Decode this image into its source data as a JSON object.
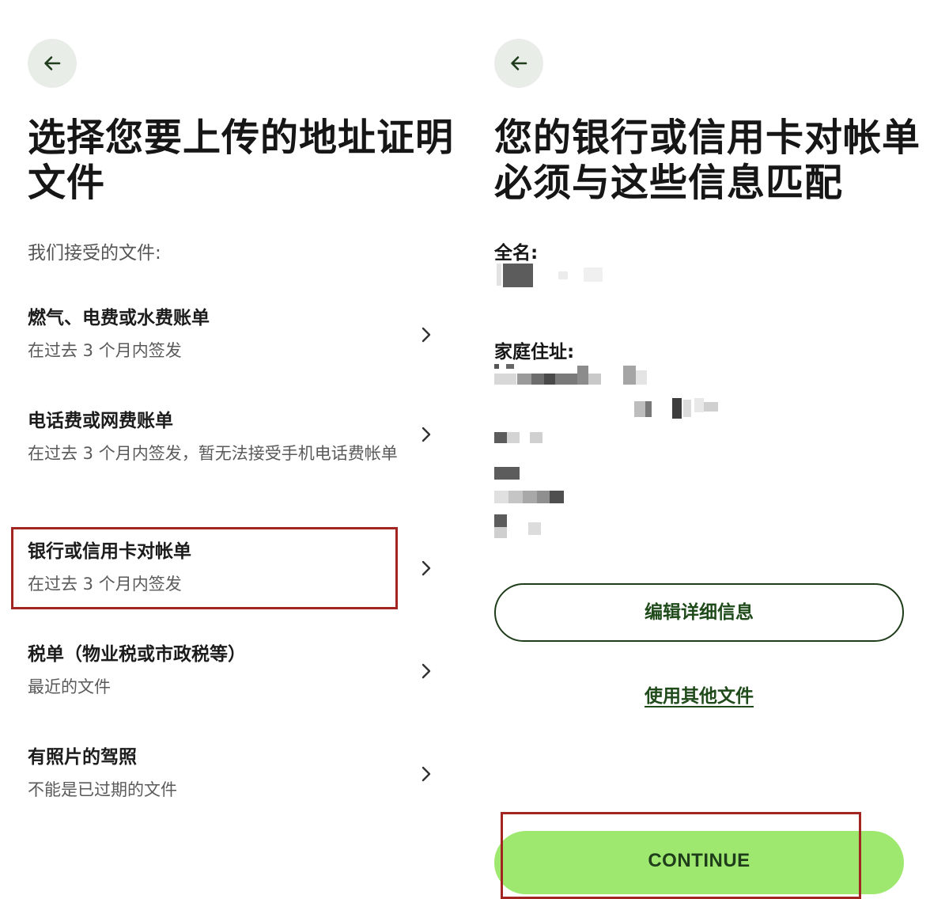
{
  "left": {
    "title": "选择您要上传的地址证明文件",
    "accepted_label": "我们接受的文件:",
    "documents": [
      {
        "title": "燃气、电费或水费账单",
        "subtitle": "在过去 3 个月内签发"
      },
      {
        "title": "电话费或网费账单",
        "subtitle": "在过去 3 个月内签发，暂无法接受手机电话费帐单"
      },
      {
        "title": "银行或信用卡对帐单",
        "subtitle": "在过去 3 个月内签发",
        "highlighted": true
      },
      {
        "title": "税单（物业税或市政税等）",
        "subtitle": "最近的文件"
      },
      {
        "title": "有照片的驾照",
        "subtitle": "不能是已过期的文件"
      }
    ]
  },
  "right": {
    "title": "您的银行或信用卡对帐单必须与这些信息匹配",
    "full_name_label": "全名:",
    "home_address_label": "家庭住址:",
    "edit_button": "编辑详细信息",
    "other_doc_link": "使用其他文件",
    "continue_button": "CONTINUE",
    "continue_highlighted": true
  },
  "icons": {
    "back": "arrow-left-icon",
    "chevron": "chevron-right-icon"
  },
  "colors": {
    "primary_green": "#9ee870",
    "dark_green": "#1f4a1a",
    "back_button_bg": "#e9ede8",
    "highlight_red": "#a32521"
  }
}
